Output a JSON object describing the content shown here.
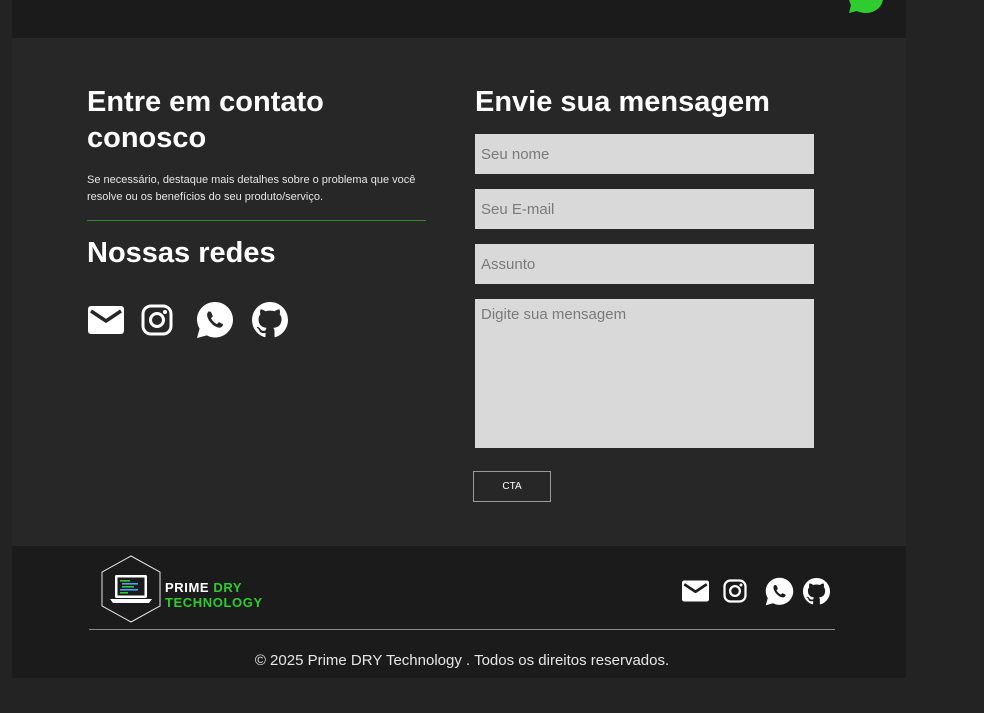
{
  "contact": {
    "title": "Entre em contato conosco",
    "description": "Se necessário, destaque mais detalhes sobre o problema que você resolve ou os benefícios do seu produto/serviço.",
    "social_title": "Nossas redes"
  },
  "form": {
    "title": "Envie sua mensagem",
    "name_placeholder": "Seu nome",
    "email_placeholder": "Seu E-mail",
    "subject_placeholder": "Assunto",
    "message_placeholder": "Digite sua mensagem",
    "cta_label": "CTA"
  },
  "footer": {
    "logo_line1_white": "PRIME ",
    "logo_line1_green": "DRY",
    "logo_line2": "TECHNOLOGY",
    "copyright": "© 2025 Prime DRY Technology . Todos os direitos reservados."
  },
  "icons": [
    "mail-icon",
    "instagram-icon",
    "whatsapp-icon",
    "github-icon"
  ],
  "colors": {
    "accent_green": "#2ecc2e",
    "background": "#272727",
    "footer_background": "#1b1b1b",
    "input_background": "#d9d9d9"
  }
}
